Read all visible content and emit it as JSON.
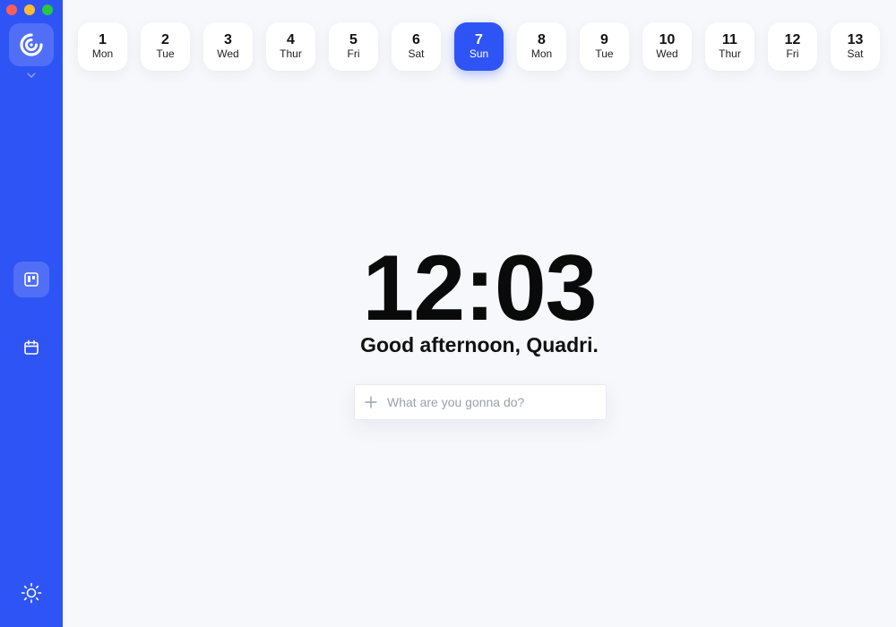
{
  "window": {
    "controls": [
      "close",
      "minimize",
      "zoom"
    ]
  },
  "sidebar": {
    "logo_icon": "app-logo-icon",
    "items": [
      {
        "name": "board",
        "icon": "board-icon",
        "active": true
      },
      {
        "name": "calendar",
        "icon": "calendar-icon",
        "active": false
      }
    ],
    "footer_icon": "sun-icon"
  },
  "days": [
    {
      "num": "1",
      "weekday": "Mon"
    },
    {
      "num": "2",
      "weekday": "Tue"
    },
    {
      "num": "3",
      "weekday": "Wed"
    },
    {
      "num": "4",
      "weekday": "Thur"
    },
    {
      "num": "5",
      "weekday": "Fri"
    },
    {
      "num": "6",
      "weekday": "Sat"
    },
    {
      "num": "7",
      "weekday": "Sun"
    },
    {
      "num": "8",
      "weekday": "Mon"
    },
    {
      "num": "9",
      "weekday": "Tue"
    },
    {
      "num": "10",
      "weekday": "Wed"
    },
    {
      "num": "11",
      "weekday": "Thur"
    },
    {
      "num": "12",
      "weekday": "Fri"
    },
    {
      "num": "13",
      "weekday": "Sat"
    }
  ],
  "selected_day_index": 6,
  "main": {
    "time": "12:03",
    "greeting": "Good afternoon, Quadri.",
    "task_placeholder": "What are you gonna do?",
    "task_value": ""
  },
  "colors": {
    "accent": "#2f54f5",
    "background": "#f7f8fb",
    "card": "#ffffff"
  }
}
